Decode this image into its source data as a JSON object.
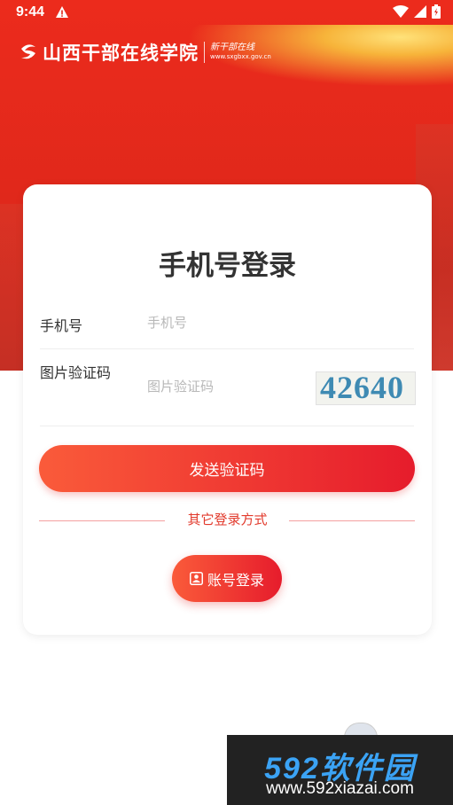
{
  "status_bar": {
    "time": "9:44"
  },
  "brand": {
    "name": "山西干部在线学院",
    "slogan": "新干部在线",
    "url": "www.sxgbxx.gov.cn"
  },
  "login": {
    "title": "手机号登录",
    "phone_label": "手机号",
    "phone_placeholder": "手机号",
    "captcha_label": "图片验证码",
    "captcha_placeholder": "图片验证码",
    "captcha_image_text": "42640",
    "send_code_button": "发送验证码",
    "other_methods_label": "其它登录方式",
    "account_login_button": "账号登录"
  },
  "watermark": {
    "logo_text": "592软件园",
    "url": "www.592xiazai.com"
  },
  "colors": {
    "brand_red": "#e61c2c",
    "accent_orange": "#fa5b3a",
    "hero_red": "#ec2b1c"
  }
}
